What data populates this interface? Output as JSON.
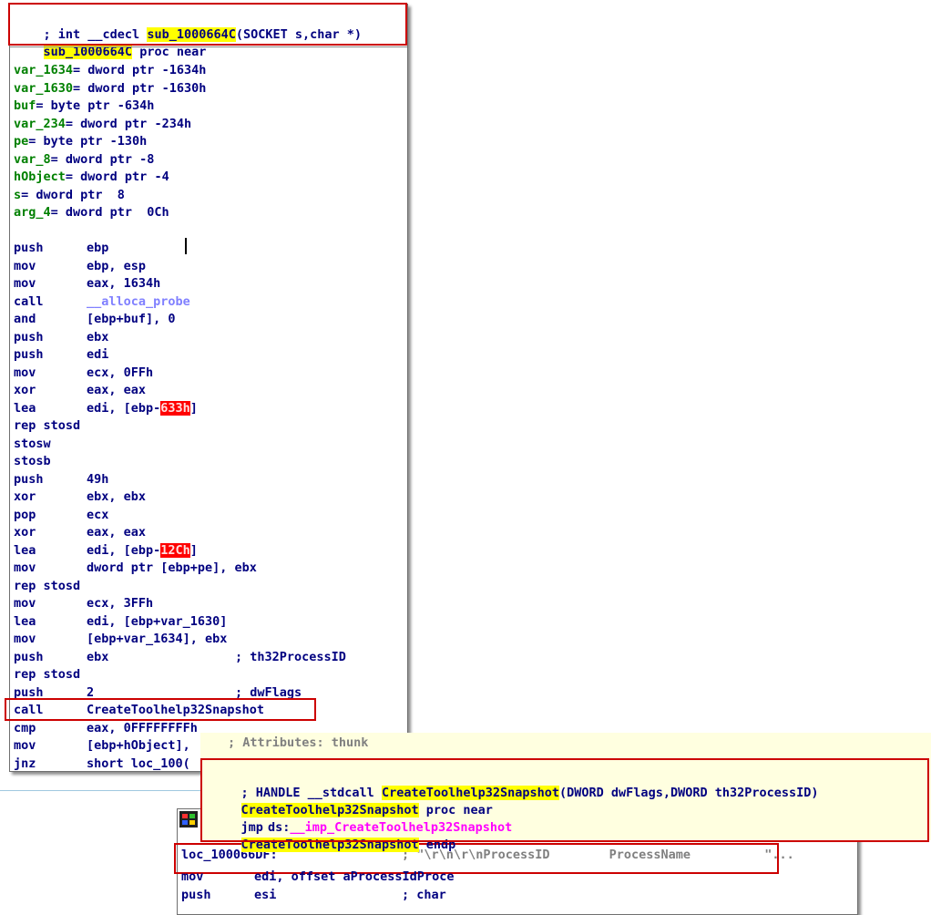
{
  "main": {
    "header": {
      "prefix": "; int __cdecl ",
      "name": "sub_1000664C",
      "args": "(SOCKET s,char *)",
      "proc_suffix": " proc near"
    },
    "vars": [
      {
        "name": "var_1634",
        "def": "= dword ptr -1634h"
      },
      {
        "name": "var_1630",
        "def": "= dword ptr -1630h"
      },
      {
        "name": "buf",
        "def": "= byte ptr -634h"
      },
      {
        "name": "var_234",
        "def": "= dword ptr -234h"
      },
      {
        "name": "pe",
        "def": "= byte ptr -130h"
      },
      {
        "name": "var_8",
        "def": "= dword ptr -8"
      },
      {
        "name": "hObject",
        "def": "= dword ptr -4"
      },
      {
        "name": "s",
        "def": "= dword ptr  8"
      },
      {
        "name": "arg_4",
        "def": "= dword ptr  0Ch"
      }
    ],
    "code": [
      {
        "ins": "push",
        "op": "ebp"
      },
      {
        "ins": "mov",
        "op": "ebp, esp"
      },
      {
        "ins": "mov",
        "op": "eax, 1634h"
      },
      {
        "ins": "call",
        "op": "__alloca_probe"
      },
      {
        "ins": "and",
        "op": "[ebp+buf], 0"
      },
      {
        "ins": "push",
        "op": "ebx"
      },
      {
        "ins": "push",
        "op": "edi"
      },
      {
        "ins": "mov",
        "op": "ecx, 0FFh"
      },
      {
        "ins": "xor",
        "op": "eax, eax"
      },
      {
        "ins": "lea",
        "op_pre": "edi, [ebp-",
        "op_red": "633h",
        "op_post": "]"
      },
      {
        "ins": "rep stosd",
        "op": ""
      },
      {
        "ins": "stosw",
        "op": ""
      },
      {
        "ins": "stosb",
        "op": ""
      },
      {
        "ins": "push",
        "op": "49h"
      },
      {
        "ins": "xor",
        "op": "ebx, ebx"
      },
      {
        "ins": "pop",
        "op": "ecx"
      },
      {
        "ins": "xor",
        "op": "eax, eax"
      },
      {
        "ins": "lea",
        "op_pre": "edi, [ebp-",
        "op_red": "12Ch",
        "op_post": "]"
      },
      {
        "ins": "mov",
        "op": "dword ptr [ebp+pe], ebx"
      },
      {
        "ins": "rep stosd",
        "op": ""
      },
      {
        "ins": "mov",
        "op": "ecx, 3FFh"
      },
      {
        "ins": "lea",
        "op": "edi, [ebp+var_1630]"
      },
      {
        "ins": "mov",
        "op": "[ebp+var_1634], ebx"
      },
      {
        "ins": "push",
        "op": "ebx",
        "cmt": "; th32ProcessID"
      },
      {
        "ins": "rep stosd",
        "op": ""
      },
      {
        "ins": "push",
        "op": "2",
        "cmt": "; dwFlags"
      },
      {
        "ins": "call",
        "op": "CreateToolhelp32Snapshot"
      },
      {
        "ins": "cmp",
        "op": "eax, 0FFFFFFFFh"
      },
      {
        "ins": "mov",
        "op": "[ebp+hObject],"
      },
      {
        "ins": "jnz",
        "op": "short loc_100("
      }
    ]
  },
  "popup": {
    "attr_comment": "; Attributes: thunk",
    "proto_prefix": "; HANDLE __stdcall ",
    "proto_name": "CreateToolhelp32Snapshot",
    "proto_args": "(DWORD dwFlags,DWORD th32ProcessID)",
    "proc_name": "CreateToolhelp32Snapshot",
    "proc_suffix": " proc near",
    "jmp_ins": "jmp",
    "jmp_op_prefix": "ds:",
    "jmp_target": "__imp_CreateToolhelp32Snapshot",
    "endp_name": "CreateToolhelp32Snapshot",
    "endp_suffix": " endp"
  },
  "lower": {
    "label": "loc_100066DF:",
    "comment": "; \"\\r\\n\\r\\nProcessID        ProcessName          \"...",
    "lines": [
      {
        "ins": "mov",
        "op": "edi, offset aProcessIdProce"
      },
      {
        "ins": "push",
        "op": "esi",
        "cmt": "; char"
      }
    ]
  }
}
